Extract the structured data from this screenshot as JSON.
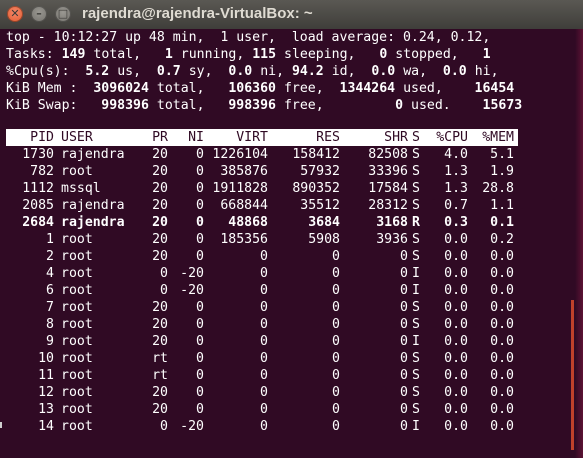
{
  "window": {
    "title": "rajendra@rajendra-VirtualBox: ~",
    "close_glyph": "✕",
    "minimize_glyph": "–",
    "maximize_glyph": "□"
  },
  "summary": {
    "line1": "top - 10:12:27 up 48 min,  1 user,  load average: 0.24, 0.12,",
    "tasks": {
      "label": "Tasks:",
      "total": "149",
      "total_label": "total,",
      "running": "1",
      "running_label": "running,",
      "sleeping": "115",
      "sleeping_label": "sleeping,",
      "stopped": "0",
      "stopped_label": "stopped,",
      "zombie": "1"
    },
    "cpu": {
      "label": "%Cpu(s):",
      "us": "5.2",
      "us_label": "us,",
      "sy": "0.7",
      "sy_label": "sy,",
      "ni": "0.0",
      "ni_label": "ni,",
      "id": "94.2",
      "id_label": "id,",
      "wa": "0.0",
      "wa_label": "wa,",
      "hi": "0.0",
      "hi_label": "hi,"
    },
    "mem": {
      "label": "KiB Mem :",
      "total": "3096024",
      "total_label": "total,",
      "free": "106360",
      "free_label": "free,",
      "used": "1344264",
      "used_label": "used,",
      "extra": "16454"
    },
    "swap": {
      "label": "KiB Swap:",
      "total": "998396",
      "total_label": "total,",
      "free": "998396",
      "free_label": "free,",
      "used": "0",
      "used_label": "used.",
      "extra": "15673"
    }
  },
  "columns": [
    "PID",
    "USER",
    "PR",
    "NI",
    "VIRT",
    "RES",
    "SHR",
    "S",
    "%CPU",
    "%MEM"
  ],
  "processes": [
    {
      "pid": "1730",
      "user": "rajendra",
      "pr": "20",
      "ni": "0",
      "virt": "1226104",
      "res": "158412",
      "shr": "82508",
      "s": "S",
      "cpu": "4.0",
      "mem": "5.1"
    },
    {
      "pid": "782",
      "user": "root",
      "pr": "20",
      "ni": "0",
      "virt": "385876",
      "res": "57932",
      "shr": "33396",
      "s": "S",
      "cpu": "1.3",
      "mem": "1.9"
    },
    {
      "pid": "1112",
      "user": "mssql",
      "pr": "20",
      "ni": "0",
      "virt": "1911828",
      "res": "890352",
      "shr": "17584",
      "s": "S",
      "cpu": "1.3",
      "mem": "28.8"
    },
    {
      "pid": "2085",
      "user": "rajendra",
      "pr": "20",
      "ni": "0",
      "virt": "668844",
      "res": "35512",
      "shr": "28312",
      "s": "S",
      "cpu": "0.7",
      "mem": "1.1"
    },
    {
      "pid": "2684",
      "user": "rajendra",
      "pr": "20",
      "ni": "0",
      "virt": "48868",
      "res": "3684",
      "shr": "3168",
      "s": "R",
      "cpu": "0.3",
      "mem": "0.1",
      "bold": true
    },
    {
      "pid": "1",
      "user": "root",
      "pr": "20",
      "ni": "0",
      "virt": "185356",
      "res": "5908",
      "shr": "3936",
      "s": "S",
      "cpu": "0.0",
      "mem": "0.2"
    },
    {
      "pid": "2",
      "user": "root",
      "pr": "20",
      "ni": "0",
      "virt": "0",
      "res": "0",
      "shr": "0",
      "s": "S",
      "cpu": "0.0",
      "mem": "0.0"
    },
    {
      "pid": "4",
      "user": "root",
      "pr": "0",
      "ni": "-20",
      "virt": "0",
      "res": "0",
      "shr": "0",
      "s": "I",
      "cpu": "0.0",
      "mem": "0.0"
    },
    {
      "pid": "6",
      "user": "root",
      "pr": "0",
      "ni": "-20",
      "virt": "0",
      "res": "0",
      "shr": "0",
      "s": "I",
      "cpu": "0.0",
      "mem": "0.0"
    },
    {
      "pid": "7",
      "user": "root",
      "pr": "20",
      "ni": "0",
      "virt": "0",
      "res": "0",
      "shr": "0",
      "s": "S",
      "cpu": "0.0",
      "mem": "0.0"
    },
    {
      "pid": "8",
      "user": "root",
      "pr": "20",
      "ni": "0",
      "virt": "0",
      "res": "0",
      "shr": "0",
      "s": "S",
      "cpu": "0.0",
      "mem": "0.0"
    },
    {
      "pid": "9",
      "user": "root",
      "pr": "20",
      "ni": "0",
      "virt": "0",
      "res": "0",
      "shr": "0",
      "s": "I",
      "cpu": "0.0",
      "mem": "0.0"
    },
    {
      "pid": "10",
      "user": "root",
      "pr": "rt",
      "ni": "0",
      "virt": "0",
      "res": "0",
      "shr": "0",
      "s": "S",
      "cpu": "0.0",
      "mem": "0.0"
    },
    {
      "pid": "11",
      "user": "root",
      "pr": "rt",
      "ni": "0",
      "virt": "0",
      "res": "0",
      "shr": "0",
      "s": "S",
      "cpu": "0.0",
      "mem": "0.0"
    },
    {
      "pid": "12",
      "user": "root",
      "pr": "20",
      "ni": "0",
      "virt": "0",
      "res": "0",
      "shr": "0",
      "s": "S",
      "cpu": "0.0",
      "mem": "0.0"
    },
    {
      "pid": "13",
      "user": "root",
      "pr": "20",
      "ni": "0",
      "virt": "0",
      "res": "0",
      "shr": "0",
      "s": "S",
      "cpu": "0.0",
      "mem": "0.0"
    },
    {
      "pid": "14",
      "user": "root",
      "pr": "0",
      "ni": "-20",
      "virt": "0",
      "res": "0",
      "shr": "0",
      "s": "I",
      "cpu": "0.0",
      "mem": "0.0"
    }
  ]
}
